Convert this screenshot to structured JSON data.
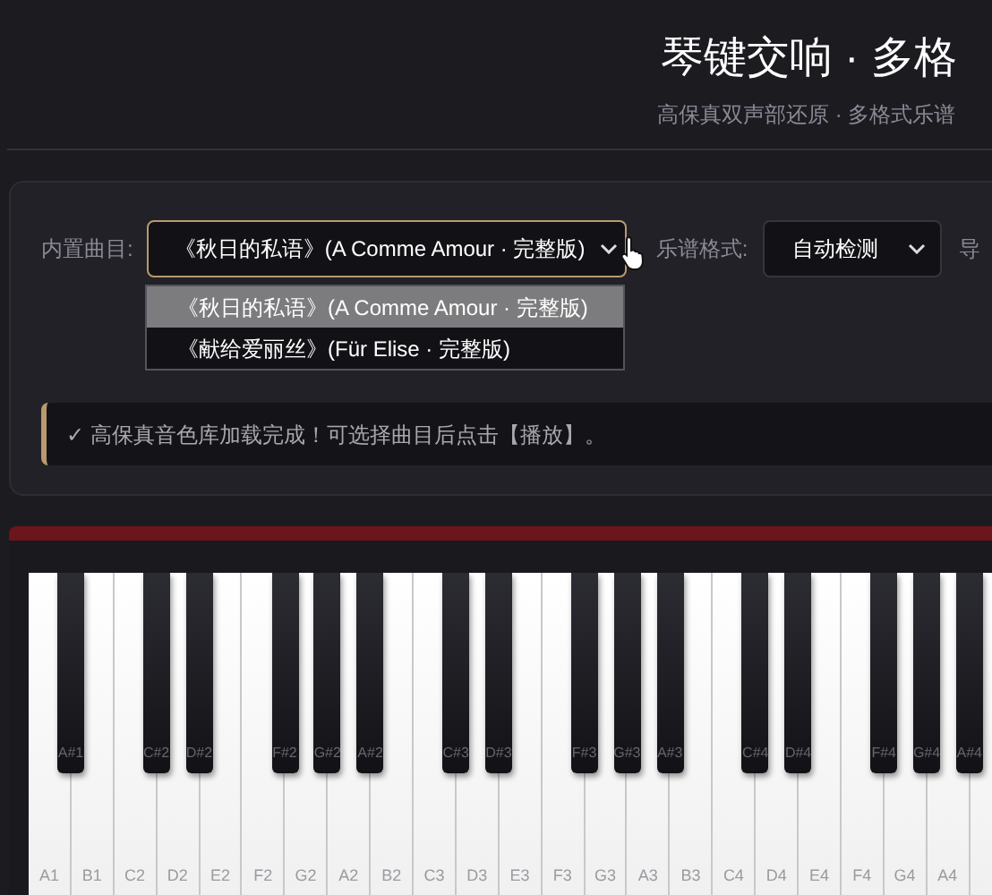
{
  "header": {
    "title": "琴键交响 · 多格",
    "subtitle": "高保真双声部还原 · 多格式乐谱"
  },
  "controls": {
    "song_label": "内置曲目:",
    "song_value": "《秋日的私语》(A Comme Amour · 完整版)",
    "song_options": [
      {
        "label": "《秋日的私语》(A Comme Amour · 完整版)",
        "selected": true
      },
      {
        "label": "《献给爱丽丝》(Für Elise · 完整版)",
        "selected": false
      }
    ],
    "format_label": "乐谱格式:",
    "format_value": "自动检测",
    "import_label": "导"
  },
  "status": "✓ 高保真音色库加载完成！可选择曲目后点击【播放】。",
  "keys": [
    {
      "label": "A1",
      "sharp": "A#1"
    },
    {
      "label": "B1"
    },
    {
      "label": "C2",
      "sharp": "C#2"
    },
    {
      "label": "D2",
      "sharp": "D#2"
    },
    {
      "label": "E2"
    },
    {
      "label": "F2",
      "sharp": "F#2"
    },
    {
      "label": "G2",
      "sharp": "G#2"
    },
    {
      "label": "A2",
      "sharp": "A#2"
    },
    {
      "label": "B2"
    },
    {
      "label": "C3",
      "sharp": "C#3"
    },
    {
      "label": "D3",
      "sharp": "D#3"
    },
    {
      "label": "E3"
    },
    {
      "label": "F3",
      "sharp": "F#3"
    },
    {
      "label": "G3",
      "sharp": "G#3"
    },
    {
      "label": "A3",
      "sharp": "A#3"
    },
    {
      "label": "B3"
    },
    {
      "label": "C4",
      "sharp": "C#4"
    },
    {
      "label": "D4",
      "sharp": "D#4"
    },
    {
      "label": "E4"
    },
    {
      "label": "F4",
      "sharp": "F#4"
    },
    {
      "label": "G4",
      "sharp": "G#4"
    },
    {
      "label": "A4",
      "sharp": "A#4"
    }
  ]
}
